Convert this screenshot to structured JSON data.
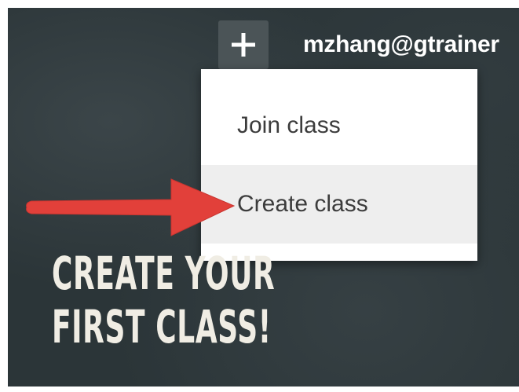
{
  "header": {
    "add_icon": "plus-icon",
    "account_email": "mzhang@gtrainer"
  },
  "menu": {
    "items": [
      {
        "label": "Join class"
      },
      {
        "label": "Create class",
        "highlighted": true
      }
    ]
  },
  "annotation": {
    "arrow_color": "#e2403a",
    "arrow_icon": "right-arrow-icon"
  },
  "promo": {
    "line1": "Create your",
    "line2": "first class!"
  },
  "colors": {
    "background": "#2b3538",
    "menu_highlight": "#eeeeee",
    "text_light": "#f0ede4"
  }
}
